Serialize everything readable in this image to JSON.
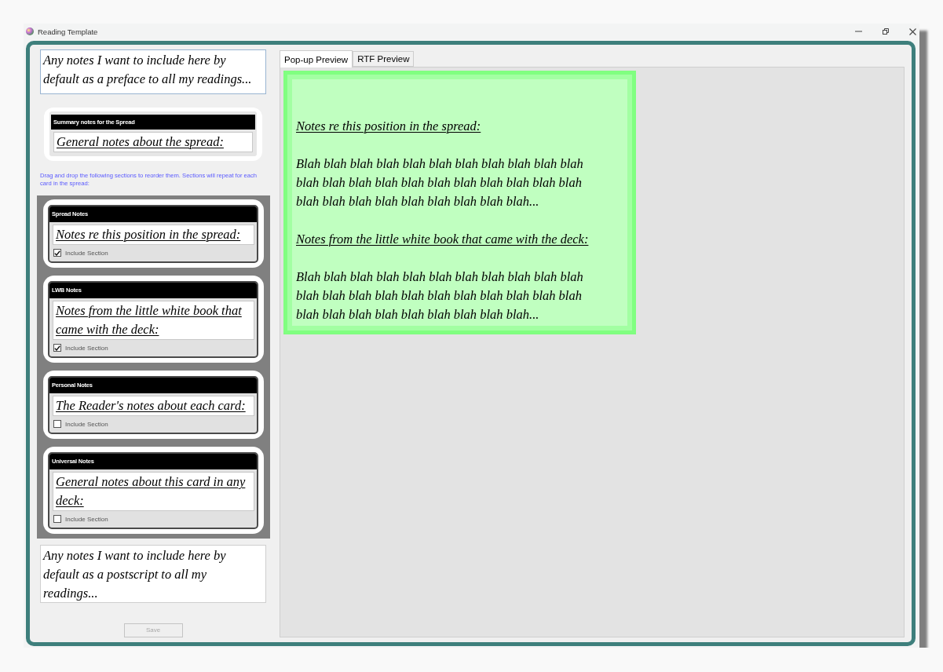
{
  "window": {
    "title": "Reading Template"
  },
  "preface_field": {
    "value": "Any notes I want to include here by default as a preface to all my readings..."
  },
  "summary_section": {
    "title": "Summary notes for the Spread",
    "value": "General notes about the spread:"
  },
  "instructions": "Drag and drop the following sections to reorder them. Sections will repeat for each card in the spread:",
  "sections": [
    {
      "title": "Spread Notes",
      "value": "Notes re this position in the spread:",
      "checkbox_label": "Include Section",
      "checked": true
    },
    {
      "title": "LWB Notes",
      "value": "Notes from the little white book that came with the deck:",
      "checkbox_label": "Include Section",
      "checked": true
    },
    {
      "title": "Personal Notes",
      "value": "The Reader's notes about each card:",
      "checkbox_label": "Include Section",
      "checked": false
    },
    {
      "title": "Universal Notes",
      "value": "General notes about this card in any deck:",
      "checkbox_label": "Include Section",
      "checked": false
    }
  ],
  "postscript_field": {
    "value": "Any notes I want to include here by default as a postscript to all my readings..."
  },
  "save_button": {
    "label": "Save",
    "disabled": true
  },
  "tabs": [
    {
      "label": "Pop-up Preview",
      "selected": true
    },
    {
      "label": "RTF Preview",
      "selected": false
    }
  ],
  "preview": {
    "blocks": [
      {
        "kind": "heading",
        "text": "Notes re this position in the spread:"
      },
      {
        "kind": "paragraph",
        "text": "Blah blah blah blah blah blah blah blah blah blah blah blah blah blah blah blah blah blah blah blah blah blah blah blah blah blah blah blah blah blah blah..."
      },
      {
        "kind": "heading",
        "text": "Notes from the little white book that came with the deck:"
      },
      {
        "kind": "paragraph",
        "text": "Blah blah blah blah blah blah blah blah blah blah blah blah blah blah blah blah blah blah blah blah blah blah blah blah blah blah blah blah blah blah blah..."
      }
    ]
  }
}
